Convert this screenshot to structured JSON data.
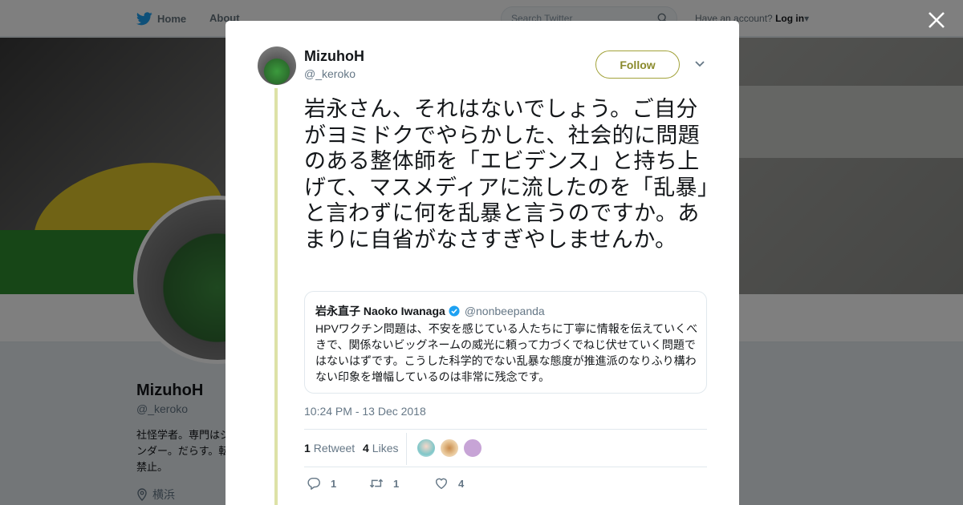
{
  "topbar": {
    "home_label": "Home",
    "about_label": "About",
    "search_placeholder": "Search Twitter",
    "account_prompt": "Have an account?",
    "login_label": "Log in"
  },
  "profile": {
    "name": "MizuhoH",
    "handle": "@_keroko",
    "bio": "社怪学者。専門はジェンダー。だらす。転載禁止。",
    "location": "横浜"
  },
  "tweet": {
    "author_name": "MizuhoH",
    "author_handle": "@_keroko",
    "follow_label": "Follow",
    "text": "岩永さん、それはないでしょう。ご自分がヨミドクでやらかした、社会的に問題のある整体師を「エビデンス」と持ち上げて、マスメディアに流したのを「乱暴」と言わずに何を乱暴と言うのですか。あまりに自省がなさすぎやしませんか。",
    "quoted": {
      "name": "岩永直子 Naoko Iwanaga",
      "handle": "@nonbeepanda",
      "text": "HPVワクチン問題は、不安を感じている人たちに丁寧に情報を伝えていくべきで、関係ないビッグネームの威光に頼って力づくでねじ伏せていく問題ではないはずです。こうした科学的でない乱暴な態度が推進派のなりふり構わない印象を増幅しているのは非常に残念です。"
    },
    "timestamp": "10:24 PM - 13 Dec 2018",
    "stats": {
      "retweet_count": "1",
      "retweet_label": "Retweet",
      "like_count": "4",
      "like_label": "Likes"
    },
    "actions": {
      "reply_count": "1",
      "retweet_count": "1",
      "like_count": "4"
    }
  },
  "colors": {
    "twitter_blue": "#1da1f2",
    "follow_accent": "#8a8a2c",
    "thread_line": "#dde2a7"
  }
}
